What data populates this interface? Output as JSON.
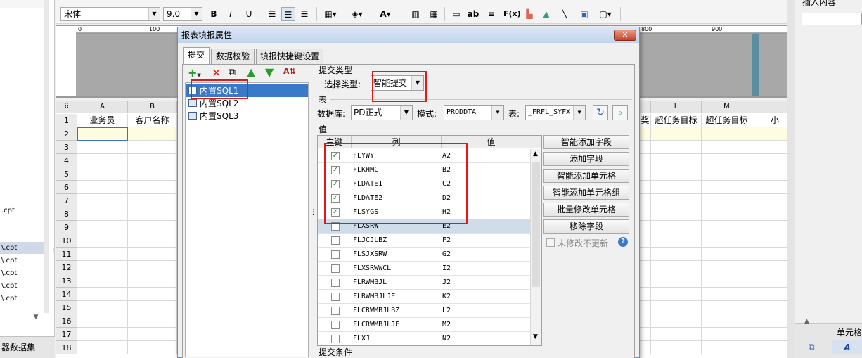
{
  "left_panel": {
    "top_label": "",
    "files": [
      ".cpt",
      "\\.cpt",
      "\\.cpt",
      "\\.cpt",
      "\\.cpt",
      "\\.cpt"
    ],
    "bottom_label": "器数据集"
  },
  "toolbar": {
    "font_family": "宋体",
    "font_size": "9.0",
    "bold": "B",
    "italic": "I",
    "underline": "U",
    "ab_label": "ab",
    "fx_label": "F(x)"
  },
  "ruler": {
    "ticks": [
      "0",
      "100",
      "800",
      "900"
    ]
  },
  "sheet": {
    "columns": [
      "A",
      "B",
      "L",
      "M"
    ],
    "rows": [
      "1",
      "2",
      "3",
      "4",
      "5",
      "6",
      "7",
      "8",
      "9",
      "10",
      "11",
      "12",
      "13",
      "14",
      "15",
      "16",
      "17",
      "18"
    ],
    "row1": {
      "A": "业务员",
      "B": "客户名称",
      "K_partial": "奖",
      "L": "超任务目标",
      "M": "超任务目标",
      "N_partial": "小"
    }
  },
  "right_panel": {
    "title": "插入内容",
    "bottom_label": "单元格"
  },
  "dialog": {
    "title": "报表填报属性",
    "close": "✕",
    "tabs": [
      "提交",
      "数据校验",
      "填报快捷键设置"
    ],
    "sql_items": [
      "内置SQL1",
      "内置SQL2",
      "内置SQL3"
    ],
    "submit_type_group": "提交类型",
    "select_type_label": "选择类型:",
    "select_type_value": "智能提交",
    "table_group": "表",
    "database_label": "数据库:",
    "database_value": "PD正式",
    "schema_label": "模式:",
    "schema_value": "PRODDTA",
    "table_label": "表:",
    "table_value": "_FRFL_SYFX",
    "value_group": "值",
    "grid_headers": [
      "主键",
      "列",
      "值"
    ],
    "grid_rows": [
      {
        "checked": true,
        "col": "FLYWY",
        "val": "A2"
      },
      {
        "checked": true,
        "col": "FLKHMC",
        "val": "B2"
      },
      {
        "checked": true,
        "col": "FLDATE1",
        "val": "C2"
      },
      {
        "checked": true,
        "col": "FLDATE2",
        "val": "D2"
      },
      {
        "checked": true,
        "col": "FLSYGS",
        "val": "H2"
      },
      {
        "checked": false,
        "col": "FLXSRW",
        "val": "E2"
      },
      {
        "checked": false,
        "col": "FLJCJLBZ",
        "val": "F2"
      },
      {
        "checked": false,
        "col": "FLSJXSRW",
        "val": "G2"
      },
      {
        "checked": false,
        "col": "FLXSRWWCL",
        "val": "I2"
      },
      {
        "checked": false,
        "col": "FLRWMBJL",
        "val": "J2"
      },
      {
        "checked": false,
        "col": "FLRWMBJLJE",
        "val": "K2"
      },
      {
        "checked": false,
        "col": "FLCRWMBJLBZ",
        "val": "L2"
      },
      {
        "checked": false,
        "col": "FLCRWMBJLJE",
        "val": "M2"
      },
      {
        "checked": false,
        "col": "FLXJ",
        "val": "N2"
      }
    ],
    "buttons": [
      "智能添加字段",
      "添加字段",
      "智能添加单元格",
      "智能添加单元格组",
      "批量修改单元格",
      "移除字段"
    ],
    "unchanged_label": "未修改不更新",
    "submit_condition_group": "提交条件"
  }
}
